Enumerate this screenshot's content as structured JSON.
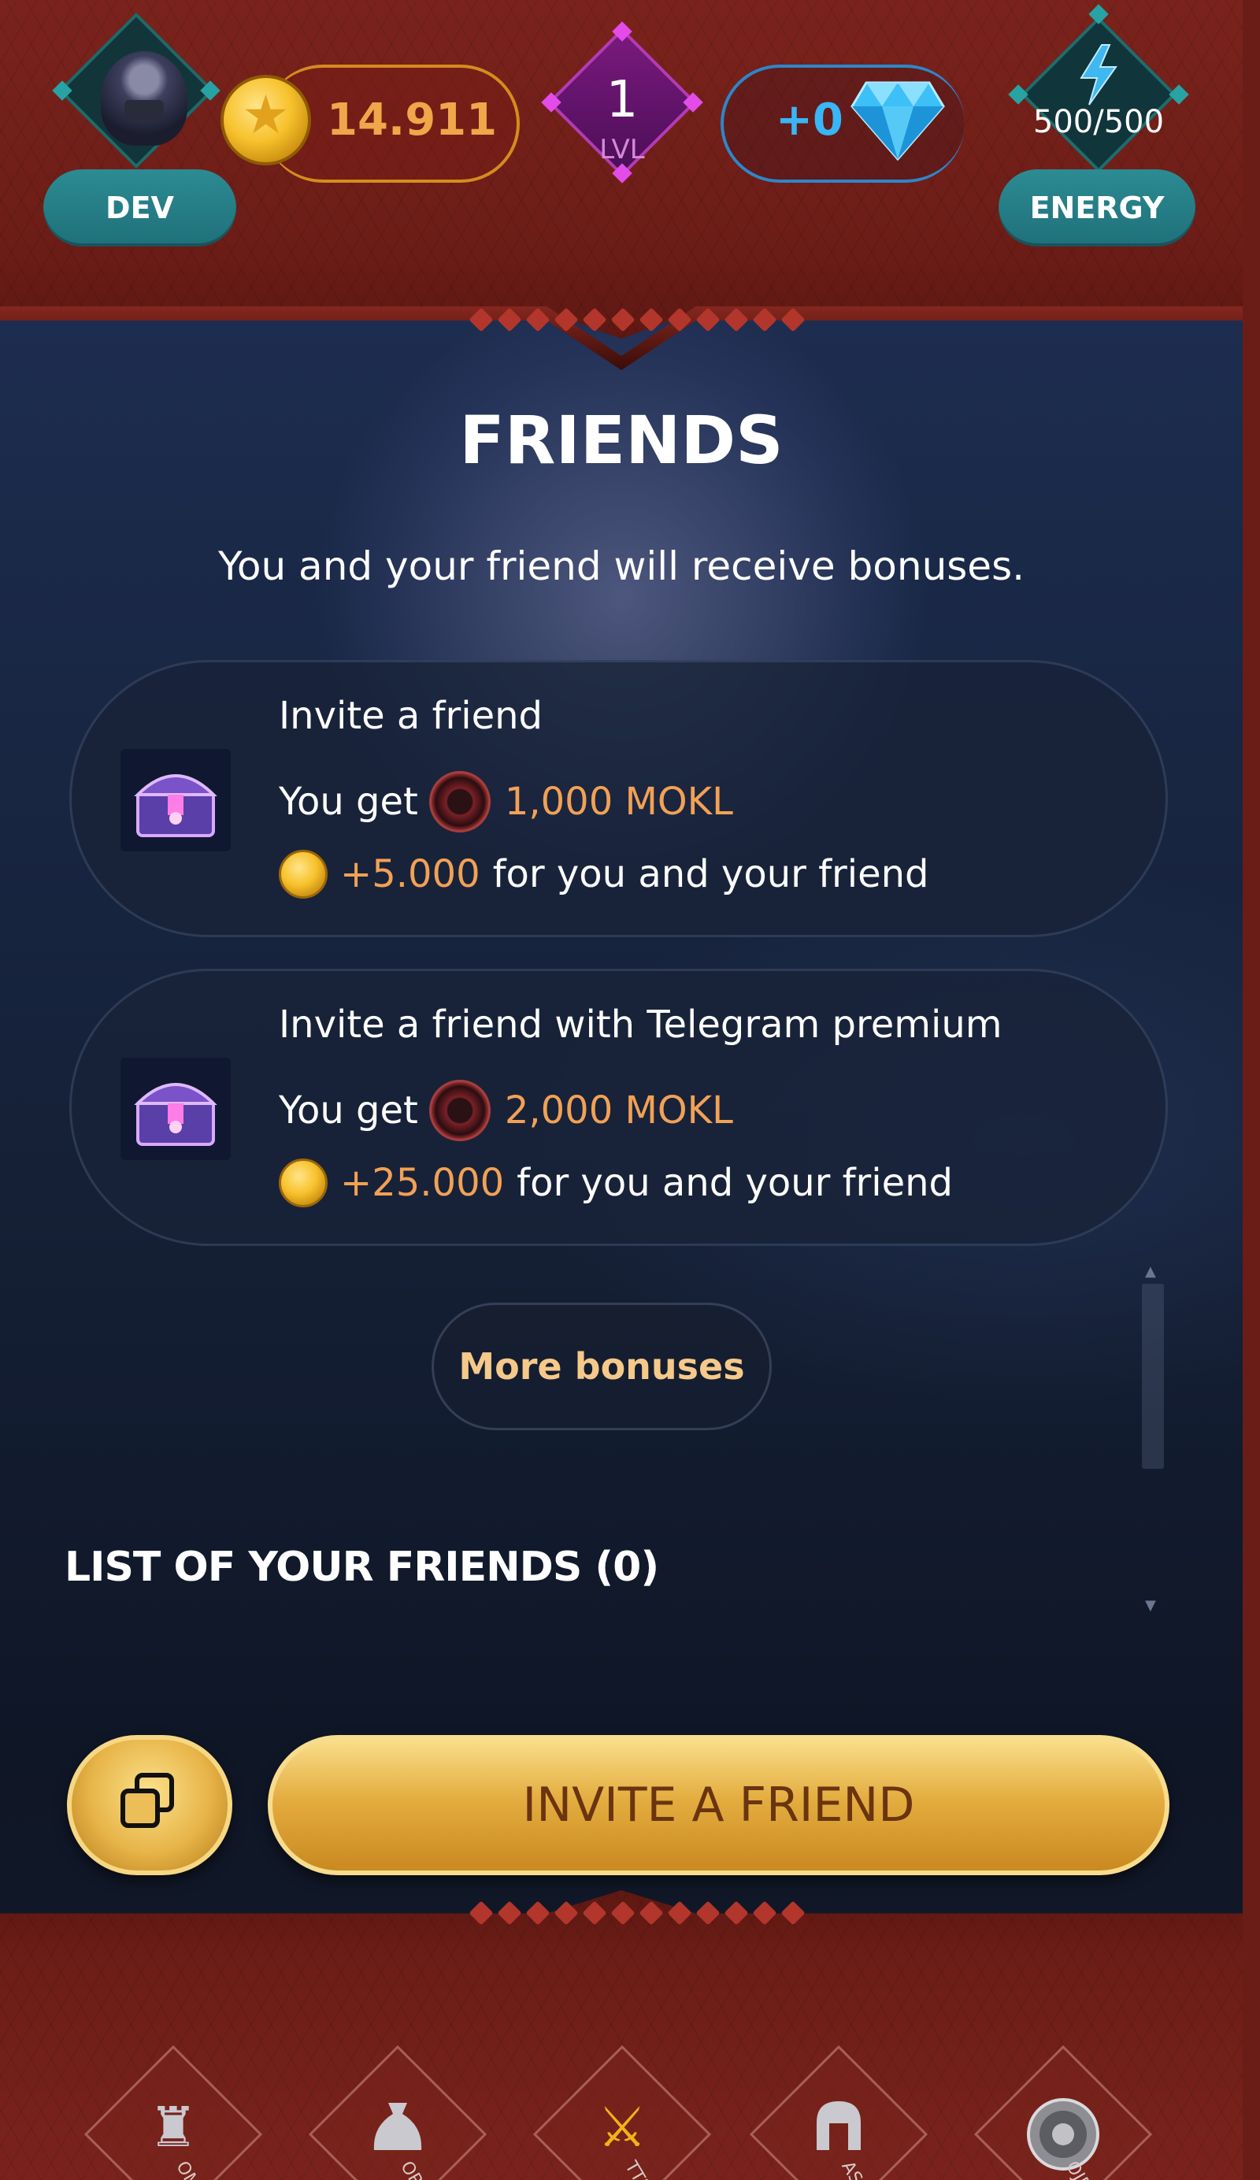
{
  "header": {
    "profile_label": "DEV",
    "coins": "14.911",
    "level": {
      "value": "1",
      "label": "LVL"
    },
    "gems": "+0",
    "energy": {
      "value": "500/500",
      "label": "ENERGY"
    }
  },
  "main": {
    "title": "FRIENDS",
    "subtitle": "You and your friend will receive bonuses.",
    "bonuses": [
      {
        "title": "Invite a friend",
        "you_get_label": "You get",
        "reward": "1,000 MOKL",
        "coin_bonus": "+5.000",
        "coin_bonus_suffix": "for you and your friend"
      },
      {
        "title": "Invite a friend with Telegram premium",
        "you_get_label": "You get",
        "reward": "2,000 MOKL",
        "coin_bonus": "+25.000",
        "coin_bonus_suffix": "for you and your friend"
      }
    ],
    "more_bonuses_label": "More bonuses",
    "friends_list_title": "LIST OF YOUR FRIENDS (0)",
    "invite_button_label": "INVITE A FRIEND"
  },
  "nav": {
    "items": [
      {
        "icon": "tower-icon",
        "label": "OME"
      },
      {
        "icon": "bag-icon",
        "label": "ORE"
      },
      {
        "icon": "crossed-swords-icon",
        "label": "TTLES",
        "active": true
      },
      {
        "icon": "helmet-icon",
        "label": "ASONS"
      },
      {
        "icon": "medallion-icon",
        "label": "OJECT"
      }
    ]
  },
  "colors": {
    "frame_red": "#6d1d17",
    "accent_teal": "#1f7079",
    "accent_gold": "#e4ad40",
    "accent_orange": "#f2a155",
    "accent_blue": "#39b6f5",
    "level_purple": "#7a1a7e"
  }
}
